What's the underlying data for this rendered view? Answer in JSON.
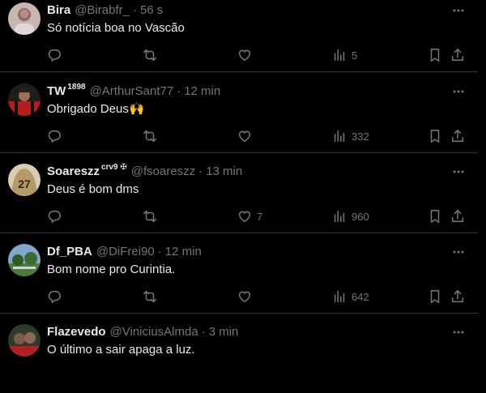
{
  "tweets": [
    {
      "name": "Bira",
      "badge": "",
      "handle": "@Birabfr_",
      "time": "56 s",
      "text": "Só notícia boa no Vascão",
      "emoji": "",
      "likes": "",
      "views": "5",
      "avatar_icon": "avatar-bira"
    },
    {
      "name": "TW",
      "badge": "1898",
      "handle": "@ArthurSant77",
      "time": "12 min",
      "text": "Obrigado Deus",
      "emoji": "🙌",
      "likes": "",
      "views": "332",
      "avatar_icon": "avatar-tw"
    },
    {
      "name": "Soareszz",
      "badge": "crv9 ✠",
      "handle": "@fsoareszz",
      "time": "13 min",
      "text": "Deus é bom dms",
      "emoji": "",
      "likes": "7",
      "views": "960",
      "avatar_icon": "avatar-soareszz"
    },
    {
      "name": "Df_PBA",
      "badge": "",
      "handle": "@DiFrei90",
      "time": "12 min",
      "text": "Bom nome pro Curintia.",
      "emoji": "",
      "likes": "",
      "views": "642",
      "avatar_icon": "avatar-dfpba"
    },
    {
      "name": "Flazevedo",
      "badge": "",
      "handle": "@ViniciusAlmda",
      "time": "3 min",
      "text": "O último a sair apaga a luz.",
      "emoji": "",
      "likes": "",
      "views": "",
      "avatar_icon": "avatar-flazevedo"
    }
  ],
  "separator": "·",
  "colors": {
    "background": "#000000",
    "text": "#e7e9ea",
    "muted": "#71767b",
    "divider": "#2f3336"
  },
  "icons": {
    "reply": "reply-icon",
    "retweet": "retweet-icon",
    "like": "heart-icon",
    "views": "views-icon",
    "bookmark": "bookmark-icon",
    "share": "share-icon",
    "more": "more-icon"
  }
}
